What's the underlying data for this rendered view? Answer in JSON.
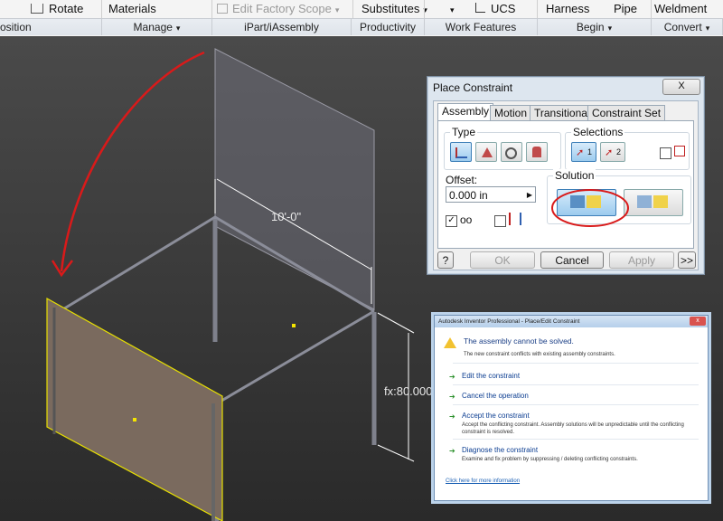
{
  "ribbon": {
    "row1": {
      "rotate": "Rotate",
      "materials": "Materials",
      "edit_factory_scope": "Edit Factory Scope",
      "substitutes": "Substitutes",
      "ucs": "UCS",
      "harness": "Harness",
      "pipe": "Pipe",
      "weldment": "Weldment"
    },
    "groups": {
      "position": "osition",
      "manage": "Manage",
      "ipart": "iPart/iAssembly",
      "productivity": "Productivity",
      "work_features": "Work Features",
      "begin": "Begin",
      "convert": "Convert"
    }
  },
  "viewport": {
    "dim_width": "10'-0\"",
    "dim_height": "fx:80.000"
  },
  "place_constraint": {
    "title": "Place Constraint",
    "close": "X",
    "tabs": [
      "Assembly",
      "Motion",
      "Transitional",
      "Constraint Set"
    ],
    "type_label": "Type",
    "selections_label": "Selections",
    "sel1": "1",
    "sel2": "2",
    "offset_label": "Offset:",
    "offset_value": "0.000 in",
    "solution_label": "Solution",
    "help": "?",
    "ok": "OK",
    "cancel": "Cancel",
    "apply": "Apply",
    "more": ">>"
  },
  "error_dialog": {
    "title": "Autodesk Inventor Professional - Place/Edit Constraint",
    "heading": "The assembly cannot be solved.",
    "subheading": "The new constraint conflicts with existing assembly constraints.",
    "options": [
      {
        "title": "Edit the constraint",
        "desc": ""
      },
      {
        "title": "Cancel the operation",
        "desc": ""
      },
      {
        "title": "Accept the constraint",
        "desc": "Accept the conflicting constraint. Assembly solutions will be unpredictable until the conflicting constraint is resolved."
      },
      {
        "title": "Diagnose the constraint",
        "desc": "Examine and fix problem by suppressing / deleting conflicting constraints."
      }
    ],
    "link": "Click here for more information"
  },
  "colors": {
    "annotation_red": "#d91a1a",
    "selection_yellow": "#e8e000",
    "panel_fill": "#7a6a5e"
  }
}
